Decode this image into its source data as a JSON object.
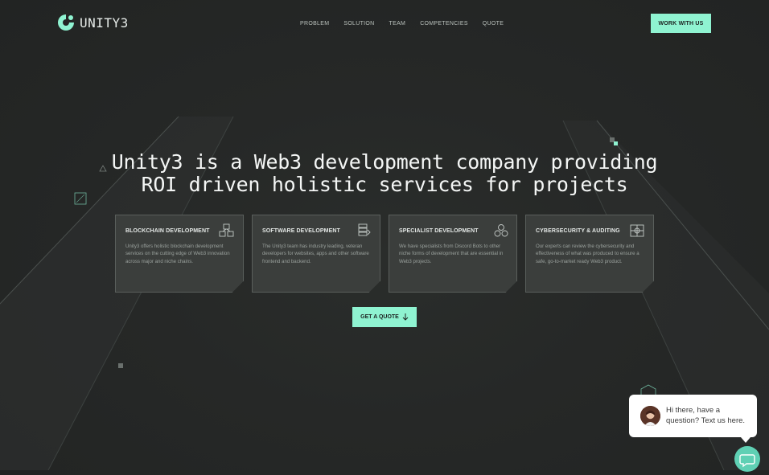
{
  "brand": {
    "name": "UNITY3",
    "accent": "#8ff3d1"
  },
  "nav": {
    "items": [
      "PROBLEM",
      "SOLUTION",
      "TEAM",
      "COMPETENCIES",
      "QUOTE"
    ]
  },
  "header": {
    "cta_label": "WORK WITH US"
  },
  "hero": {
    "heading": "Unity3 is a Web3 development company providing ROI driven holistic services for projects"
  },
  "cards": [
    {
      "title": "BLOCKCHAIN DEVELOPMENT",
      "description": "Unity3 offers holistic blockchain development services on the cutting edge of Web3 innovation across major and niche chains.",
      "icon": "blockchain-cubes-icon"
    },
    {
      "title": "SOFTWARE DEVELOPMENT",
      "description": "The Unity3 team has industry leading, veteran developers for websites, apps and other software frontend and backend.",
      "icon": "server-code-icon"
    },
    {
      "title": "SPECIALIST DEVELOPMENT",
      "description": "We have specialists from Discord Bots to other niche forms of development that are essential in Web3 projects.",
      "icon": "modules-icon"
    },
    {
      "title": "CYBERSECURITY & AUDITING",
      "description": "Our experts can review the cybersecurity and effectiveness of what was produced to ensure a safe, go-to-market ready Web3 product.",
      "icon": "network-shield-icon"
    }
  ],
  "quote_button": {
    "label": "GET A QUOTE",
    "icon": "arrow-down-icon"
  },
  "chat": {
    "message": "Hi there, have a question? Text us here.",
    "launcher_icon": "chat-icon"
  }
}
